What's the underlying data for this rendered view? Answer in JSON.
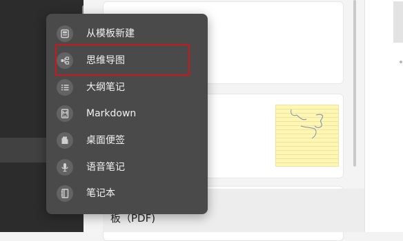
{
  "new_menu": {
    "items": [
      {
        "label": "从模板新建",
        "icon": "template-icon"
      },
      {
        "label": "思维导图",
        "icon": "mindmap-icon"
      },
      {
        "label": "大纲笔记",
        "icon": "outline-icon"
      },
      {
        "label": "Markdown",
        "icon": "markdown-icon"
      },
      {
        "label": "桌面便签",
        "icon": "sticky-note-icon"
      },
      {
        "label": "语音笔记",
        "icon": "microphone-icon"
      },
      {
        "label": "笔记本",
        "icon": "notebook-icon"
      }
    ],
    "highlighted_item": "思维导图",
    "highlight_color": "#c8171d",
    "background_color": "#4a4a4a"
  },
  "document_list": {
    "partial_title": "板（PDF)"
  },
  "colors": {
    "sidebar_bg": "#2c2c2c",
    "sticky_note_bg": "#fdf6b4"
  }
}
